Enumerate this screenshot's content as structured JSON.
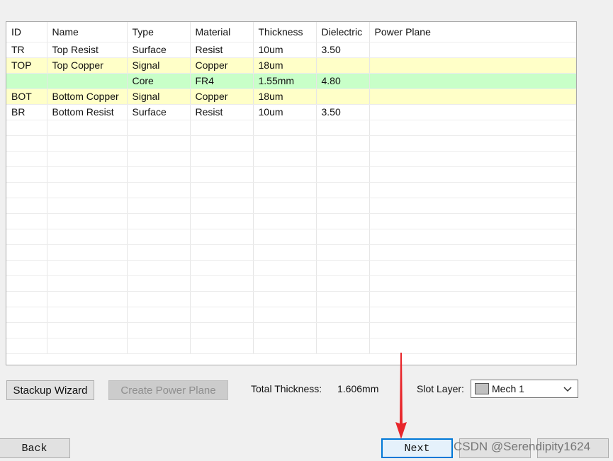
{
  "table": {
    "headers": [
      "ID",
      "Name",
      "Type",
      "Material",
      "Thickness",
      "Dielectric",
      "Power Plane"
    ],
    "rows": [
      {
        "style": "white",
        "cells": [
          "TR",
          "Top Resist",
          "Surface",
          "Resist",
          "10um",
          "3.50",
          ""
        ]
      },
      {
        "style": "yellow",
        "cells": [
          "TOP",
          "Top Copper",
          "Signal",
          "Copper",
          "18um",
          "",
          ""
        ]
      },
      {
        "style": "green",
        "cells": [
          "",
          "",
          "Core",
          "FR4",
          "1.55mm",
          "4.80",
          ""
        ]
      },
      {
        "style": "yellow",
        "cells": [
          "BOT",
          "Bottom Copper",
          "Signal",
          "Copper",
          "18um",
          "",
          ""
        ]
      },
      {
        "style": "white",
        "cells": [
          "BR",
          "Bottom Resist",
          "Surface",
          "Resist",
          "10um",
          "3.50",
          ""
        ]
      }
    ],
    "empty_rows": 15
  },
  "buttons": {
    "stackup_wizard": "Stackup Wizard",
    "create_power_plane": "Create Power Plane",
    "back": "Back",
    "next": "Next"
  },
  "total_thickness": {
    "label": "Total Thickness:",
    "value": "1.606mm"
  },
  "slot_layer": {
    "label": "Slot Layer:",
    "value": "Mech 1",
    "swatch_color": "#c0c0c0"
  },
  "watermark": "CSDN @Serendipity1624",
  "colors": {
    "row_yellow": "#ffffc8",
    "row_green": "#c8ffc8",
    "arrow_red": "#e8262b",
    "focus_blue": "#0078d7"
  }
}
